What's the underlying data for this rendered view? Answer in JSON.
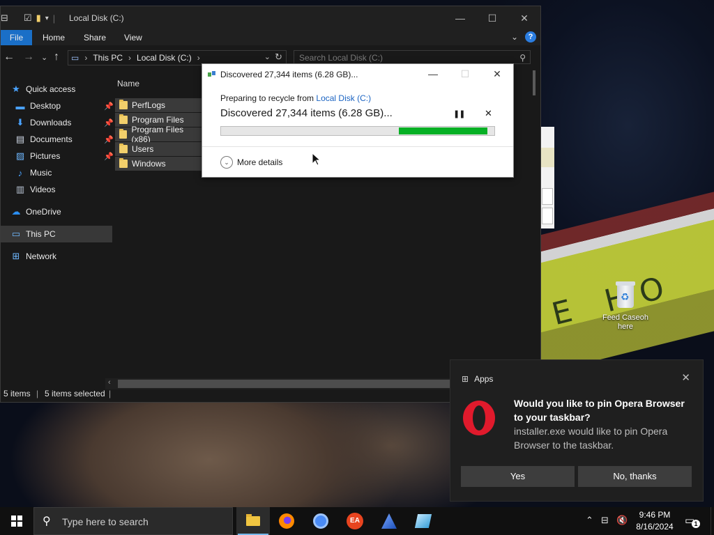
{
  "explorer": {
    "title": "Local Disk (C:)",
    "ribbon_tabs": [
      "File",
      "Home",
      "Share",
      "View"
    ],
    "address": {
      "segments": [
        "This PC",
        "Local Disk (C:)"
      ]
    },
    "search_placeholder": "Search Local Disk (C:)",
    "sidebar": [
      {
        "label": "Quick access",
        "icon": "star-icon",
        "pinned": false
      },
      {
        "label": "Desktop",
        "icon": "desktop-icon",
        "pinned": true
      },
      {
        "label": "Downloads",
        "icon": "download-icon",
        "pinned": true
      },
      {
        "label": "Documents",
        "icon": "document-icon",
        "pinned": true
      },
      {
        "label": "Pictures",
        "icon": "pictures-icon",
        "pinned": true
      },
      {
        "label": "Music",
        "icon": "music-icon",
        "pinned": false
      },
      {
        "label": "Videos",
        "icon": "video-icon",
        "pinned": false
      },
      {
        "label": "OneDrive",
        "icon": "cloud-icon",
        "pinned": false
      },
      {
        "label": "This PC",
        "icon": "computer-icon",
        "pinned": false,
        "selected": true
      },
      {
        "label": "Network",
        "icon": "network-icon",
        "pinned": false
      }
    ],
    "column_header": "Name",
    "files": [
      "PerfLogs",
      "Program Files",
      "Program Files (x86)",
      "Users",
      "Windows"
    ],
    "status": {
      "items": "5 items",
      "selected": "5 items selected"
    }
  },
  "dialog": {
    "title": "Discovered 27,344 items (6.28 GB)...",
    "preparing_prefix": "Preparing to recycle from ",
    "preparing_link": "Local Disk (C:)",
    "discovered": "Discovered 27,344 items (6.28 GB)...",
    "more_details": "More details",
    "progress": {
      "start": 0.65,
      "end": 0.975
    }
  },
  "desktop": {
    "icon_label": "Feed Caseoh here"
  },
  "toast": {
    "app": "Apps",
    "title": "Would you like to pin Opera Browser to your taskbar?",
    "body": "installer.exe would like to pin Opera Browser to the taskbar.",
    "yes": "Yes",
    "no": "No, thanks"
  },
  "taskbar": {
    "search_placeholder": "Type here to search",
    "time": "9:46 PM",
    "date": "8/16/2024",
    "notification_count": "1"
  }
}
